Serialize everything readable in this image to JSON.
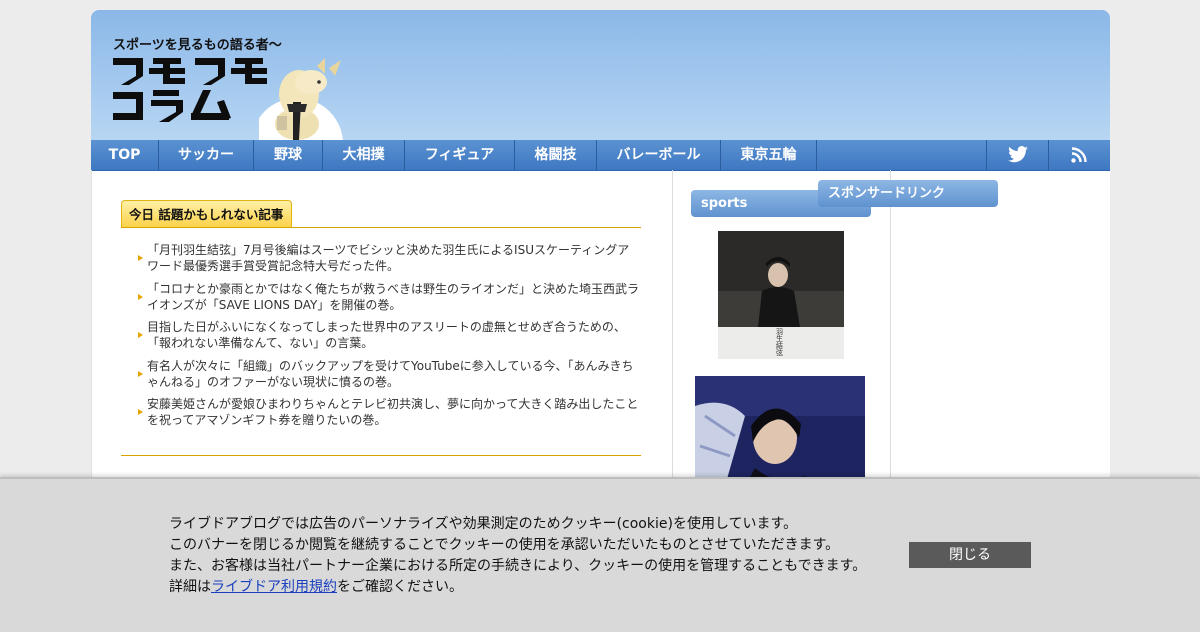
{
  "header": {
    "tagline": "スポーツを見るもの語る者〜",
    "logo_text": "フモフモコラム"
  },
  "nav": {
    "items": [
      {
        "label": "TOP"
      },
      {
        "label": "サッカー"
      },
      {
        "label": "野球"
      },
      {
        "label": "大相撲"
      },
      {
        "label": "フィギュア"
      },
      {
        "label": "格闘技"
      },
      {
        "label": "バレーボール"
      },
      {
        "label": "東京五輪"
      }
    ],
    "icons": [
      "twitter-icon",
      "rss-icon"
    ]
  },
  "main": {
    "section_title": "今日 話題かもしれない記事",
    "articles": [
      "「月刊羽生結弦」7月号後編はスーツでビシッと決めた羽生氏によるISUスケーティングアワード最優秀選手賞受賞記念特大号だった件。",
      "「コロナとか豪雨とかではなく俺たちが救うべきは野生のライオンだ」と決めた埼玉西武ライオンズが「SAVE LIONS DAY」を開催の巻。",
      "目指した日がふいになくなってしまった世界中のアスリートの虚無とせめぎ合うための、「報われない準備なんて、ない」の言葉。",
      "有名人が次々に「組織」のバックアップを受けてYouTubeに参入している今、「あんみきちゃんねる」のオファーがない現状に憤るの巻。",
      "安藤美姫さんが愛娘ひまわりちゃんとテレビ初共演し、夢に向かって大きく踏み出したことを祝ってアマゾンギフト券を贈りたいの巻。"
    ]
  },
  "sidebar": {
    "sports_title": "sports",
    "book_cover_text": "羽生結弦",
    "sponsor_title": "スポンサードリンク"
  },
  "cookie_banner": {
    "line1": "ライブドアブログでは広告のパーソナライズや効果測定のためクッキー(cookie)を使用しています。",
    "line2": "このバナーを閉じるか閲覧を継続することでクッキーの使用を承認いただいたものとさせていただきます。",
    "line3": "また、お客様は当社パートナー企業における所定の手続きにより、クッキーの使用を管理することもできます。",
    "line4_prefix": "詳細は",
    "link_text": "ライブドア利用規約",
    "line4_suffix": "をご確認ください。",
    "close_label": "閉じる"
  },
  "colors": {
    "nav_blue": "#4a84c9",
    "accent_gold": "#d5a400",
    "header_sky": "#a3c8ef"
  }
}
